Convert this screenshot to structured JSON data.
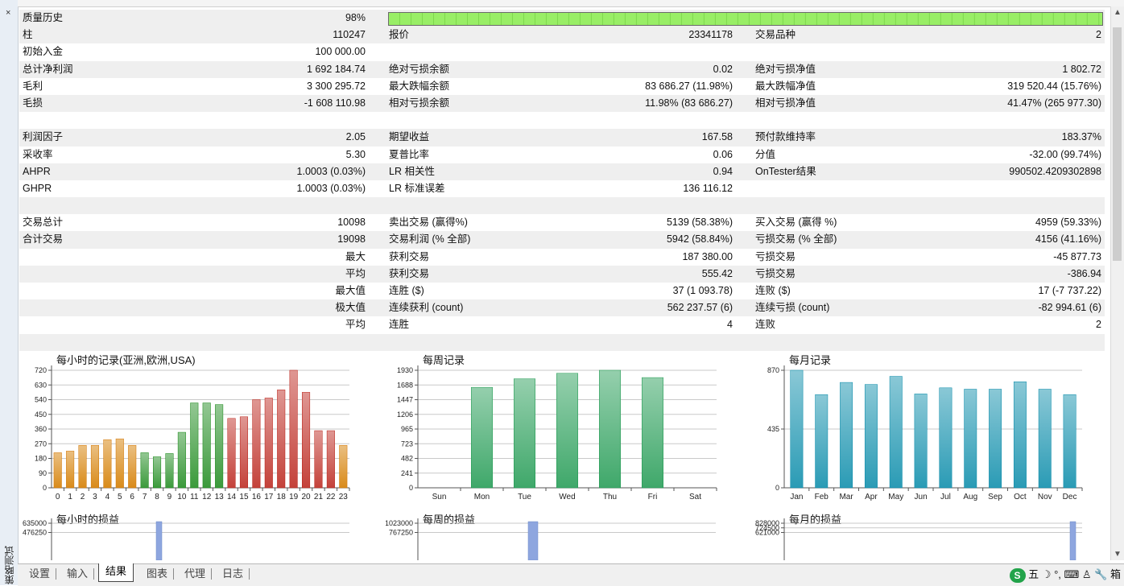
{
  "sidebar": {
    "close": "×",
    "label": "策略测试"
  },
  "rows": [
    {
      "shade": true,
      "c1": [
        "质量历史",
        "98%"
      ],
      "progress": 0.98
    },
    {
      "shade": true,
      "c1": [
        "柱",
        "110247"
      ],
      "c2": [
        "报价",
        "23341178"
      ],
      "c3": [
        "交易品种",
        "2"
      ]
    },
    {
      "shade": false,
      "c1": [
        "初始入金",
        "100 000.00"
      ]
    },
    {
      "shade": true,
      "c1": [
        "总计净利润",
        "1 692 184.74"
      ],
      "c2": [
        "绝对亏损余额",
        "0.02"
      ],
      "c3": [
        "绝对亏损净值",
        "1 802.72"
      ]
    },
    {
      "shade": false,
      "c1": [
        "毛利",
        "3 300 295.72"
      ],
      "c2": [
        "最大跌幅余额",
        "83 686.27 (11.98%)"
      ],
      "c3": [
        "最大跌幅净值",
        "319 520.44 (15.76%)"
      ]
    },
    {
      "shade": true,
      "c1": [
        "毛损",
        "-1 608 110.98"
      ],
      "c2": [
        "相对亏损余额",
        "11.98% (83 686.27)"
      ],
      "c3": [
        "相对亏损净值",
        "41.47% (265 977.30)"
      ]
    },
    {
      "shade": false
    },
    {
      "shade": true,
      "c1": [
        "利润因子",
        "2.05"
      ],
      "c2": [
        "期望收益",
        "167.58"
      ],
      "c3": [
        "预付款维持率",
        "183.37%"
      ]
    },
    {
      "shade": false,
      "c1": [
        "采收率",
        "5.30"
      ],
      "c2": [
        "夏普比率",
        "0.06"
      ],
      "c3": [
        "分值",
        "-32.00 (99.74%)"
      ]
    },
    {
      "shade": true,
      "c1": [
        "AHPR",
        "1.0003 (0.03%)"
      ],
      "c2": [
        "LR 相关性",
        "0.94"
      ],
      "c3": [
        "OnTester结果",
        "990502.4209302898"
      ]
    },
    {
      "shade": false,
      "c1": [
        "GHPR",
        "1.0003 (0.03%)"
      ],
      "c2": [
        "LR 标准误差",
        "136 116.12"
      ]
    },
    {
      "shade": true
    },
    {
      "shade": false,
      "c1": [
        "交易总计",
        "10098"
      ],
      "c2": [
        "卖出交易 (赢得%)",
        "5139 (58.38%)"
      ],
      "c3": [
        "买入交易 (赢得 %)",
        "4959 (59.33%)"
      ]
    },
    {
      "shade": true,
      "c1": [
        "合计交易",
        "19098"
      ],
      "c2": [
        "交易利润 (% 全部)",
        "5942 (58.84%)"
      ],
      "c3": [
        "亏损交易 (% 全部)",
        "4156 (41.16%)"
      ]
    },
    {
      "shade": false,
      "c1": [
        "",
        "最大"
      ],
      "c2": [
        "获利交易",
        "187 380.00"
      ],
      "c3": [
        "亏损交易",
        "-45 877.73"
      ]
    },
    {
      "shade": true,
      "c1": [
        "",
        "平均"
      ],
      "c2": [
        "获利交易",
        "555.42"
      ],
      "c3": [
        "亏损交易",
        "-386.94"
      ]
    },
    {
      "shade": false,
      "c1": [
        "",
        "最大值"
      ],
      "c2": [
        "连胜 ($)",
        "37 (1 093.78)"
      ],
      "c3": [
        "连败 ($)",
        "17 (-7 737.22)"
      ]
    },
    {
      "shade": true,
      "c1": [
        "",
        "极大值"
      ],
      "c2": [
        "连续获利 (count)",
        "562 237.57 (6)"
      ],
      "c3": [
        "连续亏损 (count)",
        "-82 994.61 (6)"
      ]
    },
    {
      "shade": false,
      "c1": [
        "",
        "平均"
      ],
      "c2": [
        "连胜",
        "4"
      ],
      "c3": [
        "连败",
        "2"
      ]
    },
    {
      "shade": true
    }
  ],
  "chart_data": [
    {
      "type": "bar",
      "title": "每小时的记录(亚洲,欧洲,USA)",
      "categories": [
        "0",
        "1",
        "2",
        "3",
        "4",
        "5",
        "6",
        "7",
        "8",
        "9",
        "10",
        "11",
        "12",
        "13",
        "14",
        "15",
        "16",
        "17",
        "18",
        "19",
        "20",
        "21",
        "22",
        "23"
      ],
      "values": [
        215,
        225,
        260,
        260,
        295,
        300,
        260,
        215,
        190,
        210,
        340,
        520,
        520,
        510,
        425,
        435,
        540,
        550,
        600,
        720,
        585,
        350,
        350,
        260
      ],
      "yticks": [
        "0",
        "90",
        "180",
        "270",
        "360",
        "450",
        "540",
        "630",
        "720"
      ],
      "ylim": [
        0,
        720
      ],
      "colors": [
        "#d98b1a",
        "#d98b1a",
        "#d98b1a",
        "#d98b1a",
        "#d98b1a",
        "#d98b1a",
        "#d98b1a",
        "#3b9a3b",
        "#3b9a3b",
        "#3b9a3b",
        "#3b9a3b",
        "#3b9a3b",
        "#3b9a3b",
        "#3b9a3b",
        "#c4423a",
        "#c4423a",
        "#c4423a",
        "#c4423a",
        "#c4423a",
        "#c4423a",
        "#c4423a",
        "#c4423a",
        "#c4423a",
        "#d98b1a"
      ]
    },
    {
      "type": "bar",
      "title": "每周记录",
      "categories": [
        "Sun",
        "Mon",
        "Tue",
        "Wed",
        "Thu",
        "Fri",
        "Sat"
      ],
      "values": [
        0,
        1650,
        1790,
        1880,
        1930,
        1810,
        0
      ],
      "yticks": [
        "0",
        "241",
        "482",
        "723",
        "965",
        "1206",
        "1447",
        "1688",
        "1930"
      ],
      "ylim": [
        0,
        1930
      ],
      "color": "#3fa86a"
    },
    {
      "type": "bar",
      "title": "每月记录",
      "categories": [
        "Jan",
        "Feb",
        "Mar",
        "Apr",
        "May",
        "Jun",
        "Jul",
        "Aug",
        "Sep",
        "Oct",
        "Nov",
        "Dec"
      ],
      "values": [
        870,
        690,
        780,
        765,
        825,
        695,
        740,
        730,
        730,
        785,
        730,
        690
      ],
      "yticks": [
        "0",
        "435",
        "870"
      ],
      "ylim": [
        0,
        870
      ],
      "color": "#2a9bb5"
    },
    {
      "type": "bar",
      "title": "每小时的损益",
      "yticks": [
        "635000",
        "476250"
      ],
      "ylim": [
        0,
        635000
      ]
    },
    {
      "type": "bar",
      "title": "每周的损益",
      "yticks": [
        "1023000",
        "767250"
      ],
      "ylim": [
        0,
        1023000
      ]
    },
    {
      "type": "bar",
      "title": "每月的损益",
      "yticks": [
        "828000",
        "724500",
        "621000"
      ],
      "ylim": [
        0,
        828000
      ]
    }
  ],
  "tabs": [
    "设置",
    "输入",
    "结果",
    "图表",
    "代理",
    "日志"
  ],
  "active_tab": "结果",
  "tray": {
    "ime_icon": "S",
    "ime_mode": "五",
    "text": "箱"
  }
}
